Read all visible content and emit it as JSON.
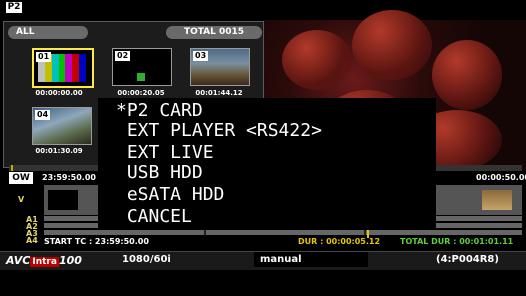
{
  "page_tag": "P2",
  "browser": {
    "filter_label": "ALL",
    "total_label": "TOTAL 0015",
    "clips": [
      {
        "number": "01",
        "timecode": "00:00:00.00",
        "selected": true
      },
      {
        "number": "02",
        "timecode": "00:00:20.05",
        "selected": false
      },
      {
        "number": "03",
        "timecode": "00:01:44.12",
        "selected": false
      },
      {
        "number": "04",
        "timecode": "00:01:30.09",
        "selected": false
      }
    ]
  },
  "source_menu": {
    "items": [
      "*P2 CARD",
      " EXT PLAYER <RS422>",
      " EXT LIVE",
      " USB HDD",
      " eSATA HDD",
      " CANCEL"
    ]
  },
  "timeline": {
    "mode_label": "OW",
    "left_timecode": "23:59:50.00",
    "right_timecode": "00:00:50.00",
    "tracks": [
      "V",
      "A1",
      "A2",
      "A3",
      "A4"
    ],
    "start_tc": "START TC : 23:59:50.00",
    "dur": "DUR : 00:00:05.12",
    "total_dur": "TOTAL DUR : 00:01:01.11"
  },
  "status_bar": {
    "codec_prefix": "AVC",
    "codec_mid": "Intra",
    "codec_suffix": "100",
    "format": "1080/60i",
    "mode": "manual",
    "clip_id": "(4:P004R8)"
  },
  "colors": {
    "highlight": "#ffe94a",
    "playhead": "#e5c400",
    "track_label": "#e3d66a",
    "total_dur": "#5ecf3a"
  }
}
